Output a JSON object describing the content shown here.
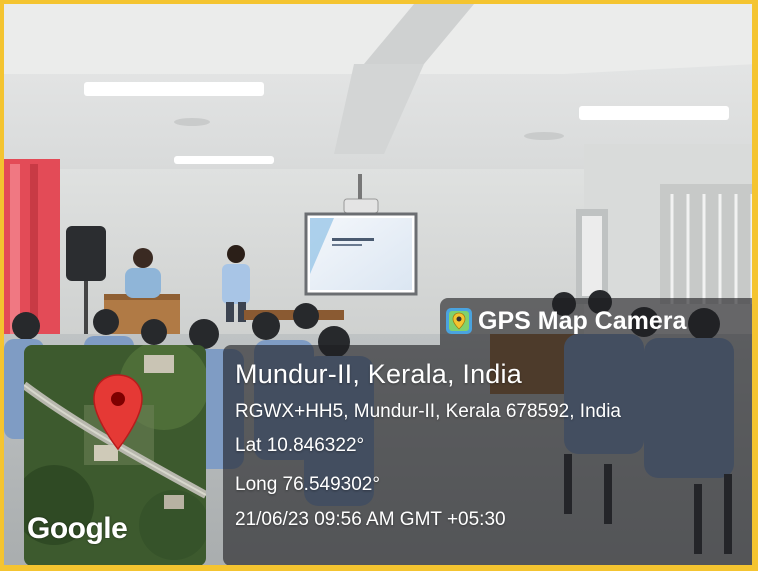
{
  "app": {
    "brand_name": "GPS Map Camera",
    "brand_icon": "map-camera-icon"
  },
  "location": {
    "place": "Mundur-II, Kerala, India",
    "address": "RGWX+HH5, Mundur-II, Kerala 678592, India",
    "latitude": "Lat 10.846322°",
    "longitude": "Long 76.549302°",
    "datetime": "21/06/23 09:56 AM GMT +05:30"
  },
  "map": {
    "provider_label": "Google",
    "pin_color": "#e53935"
  },
  "colors": {
    "frame": "#f4c430"
  }
}
